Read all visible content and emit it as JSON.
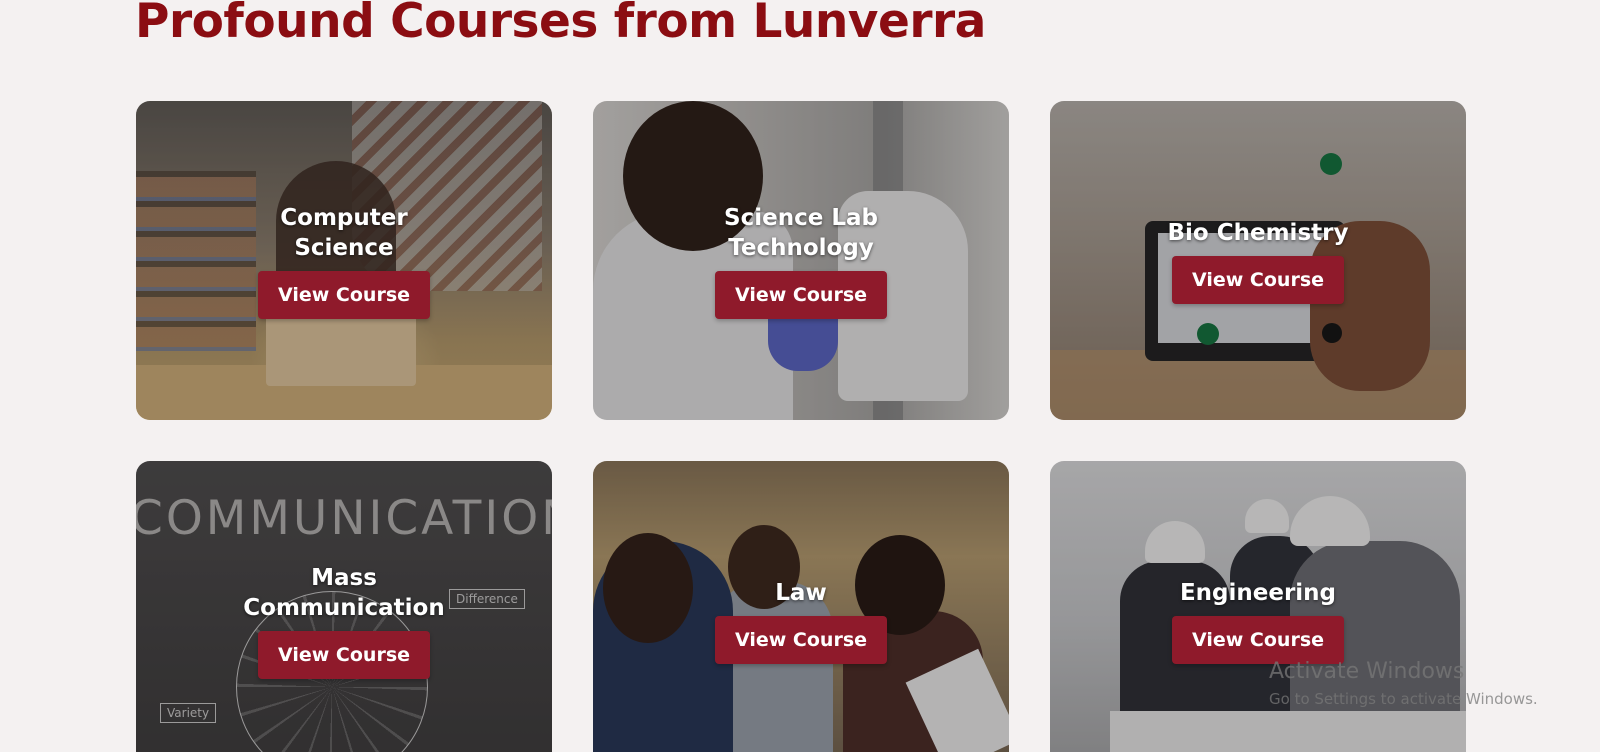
{
  "page": {
    "title": "Profound Courses from Lunverra"
  },
  "courses": [
    {
      "name": "Computer Science",
      "button": "View Course"
    },
    {
      "name": "Science Lab Technology",
      "button": "View Course"
    },
    {
      "name": "Bio Chemistry",
      "button": "View Course"
    },
    {
      "name": "Mass Communication",
      "button": "View Course"
    },
    {
      "name": "Law",
      "button": "View Course"
    },
    {
      "name": "Engineering",
      "button": "View Course"
    }
  ],
  "images": {
    "mass_communication": {
      "banner_word": "COMMUNICATION",
      "tag_difference": "Difference",
      "tag_variety": "Variety"
    }
  },
  "watermark": {
    "title": "Activate Windows",
    "subtitle": "Go to Settings to activate Windows."
  },
  "colors": {
    "title": "#8b0d12",
    "button": "#8f1a2b",
    "background": "#f4f1f1"
  }
}
